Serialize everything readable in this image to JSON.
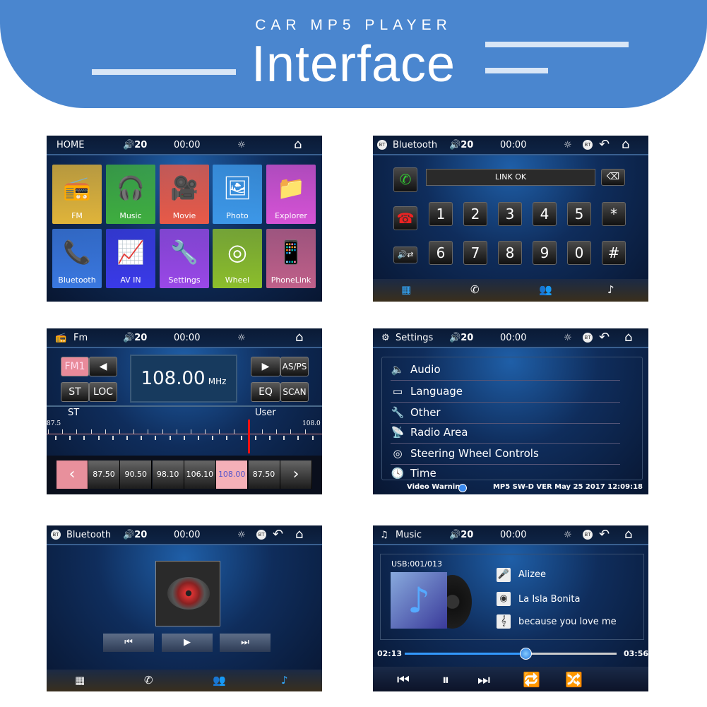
{
  "banner": {
    "subtitle": "CAR MP5 PLAYER",
    "title": "Interface",
    "color": "#4a86cf"
  },
  "status": {
    "volume": "20",
    "time": "00:00",
    "bt_badge": "BT"
  },
  "home": {
    "title": "HOME",
    "tiles": [
      {
        "label": "FM",
        "icon": "radio-icon",
        "color": "#e0b43a"
      },
      {
        "label": "Music",
        "icon": "headphones-icon",
        "color": "#3fae3f"
      },
      {
        "label": "Movie",
        "icon": "video-camera-icon",
        "color": "#e85a48"
      },
      {
        "label": "Photo",
        "icon": "photo-icon",
        "color": "#3d98e8"
      },
      {
        "label": "Explorer",
        "icon": "folder-icon",
        "color": "#d653d6"
      },
      {
        "label": "Bluetooth",
        "icon": "phone-icon",
        "color": "#3a78e0"
      },
      {
        "label": "AV IN",
        "icon": "av-in-icon",
        "color": "#3a3ae8"
      },
      {
        "label": "Settings",
        "icon": "tools-icon",
        "color": "#9a48e8"
      },
      {
        "label": "Wheel",
        "icon": "steering-wheel-icon",
        "color": "#8cbe2c"
      },
      {
        "label": "PhoneLink",
        "icon": "phonelink-icon",
        "color": "#c0608a"
      }
    ]
  },
  "dial": {
    "title": "Bluetooth",
    "display": "LINK OK",
    "keys": [
      "1",
      "2",
      "3",
      "4",
      "5",
      "*",
      "6",
      "7",
      "8",
      "9",
      "0",
      "#"
    ]
  },
  "fm": {
    "title": "Fm",
    "band": "FM1",
    "st": "ST",
    "loc": "LOC",
    "freq": "108.00",
    "unit": "MHz",
    "asps": "AS/PS",
    "eq": "EQ",
    "scan": "SCAN",
    "scale_label_left": "ST",
    "scale_label_right": "User",
    "scale_min": "87.5",
    "scale_max": "108.0",
    "current": 108.0,
    "presets": [
      "87.50",
      "90.50",
      "98.10",
      "106.10",
      "108.00",
      "87.50"
    ],
    "active_preset": 4
  },
  "settings": {
    "title": "Settings",
    "items": [
      "Audio",
      "Language",
      "Other",
      "Radio Area",
      "Steering Wheel Controls",
      "Time"
    ],
    "video_warning": "Video Warning",
    "version": "MP5 SW-D VER May 25 2017 12:09:18"
  },
  "btmusic": {
    "title": "Bluetooth"
  },
  "music": {
    "title": "Music",
    "usb": "USB:001/013",
    "artist": "Alizee",
    "album": "La Isla Bonita",
    "song": "because you love me",
    "elapsed": "02:13",
    "total": "03:56",
    "progress": 0.57
  }
}
